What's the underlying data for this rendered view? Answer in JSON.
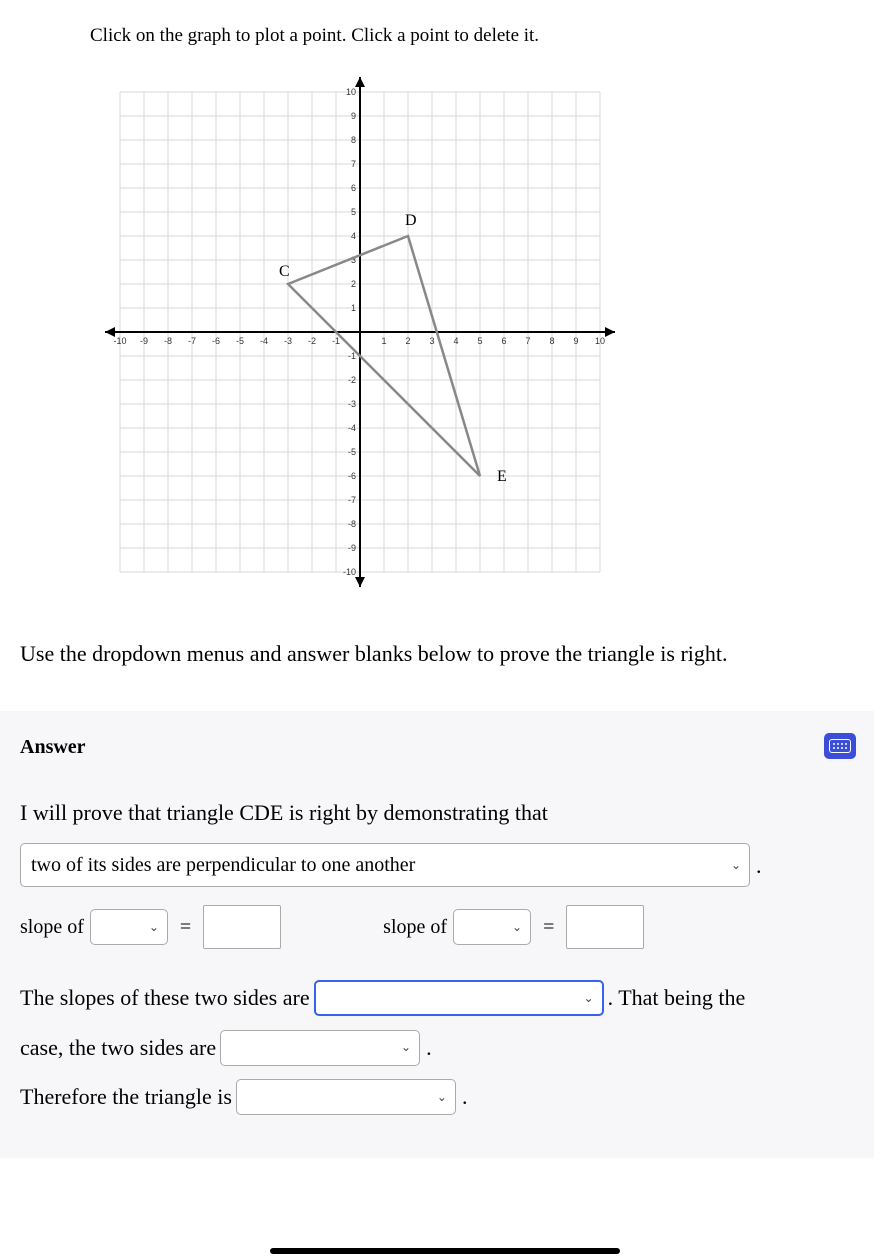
{
  "instruction": "Click on the graph to plot a point. Click a point to delete it.",
  "prompt2": "Use the dropdown menus and answer blanks below to prove the triangle is right.",
  "answer_header": "Answer",
  "proof_intro": "I will prove that triangle CDE is right by demonstrating that",
  "perpendicular_option": "two of its sides are perpendicular to one another",
  "slope_of": "slope of",
  "equals": "=",
  "slopes_line_prefix": "The slopes of these two sides are",
  "slopes_line_suffix": ". That being the",
  "case_line_prefix": "case, the two sides are",
  "therefore_prefix": "Therefore the triangle is",
  "period": ".",
  "chart_data": {
    "type": "scatter",
    "title": "",
    "xlabel": "",
    "ylabel": "",
    "xlim": [
      -10,
      10
    ],
    "ylim": [
      -10,
      10
    ],
    "x_ticks": [
      -10,
      -9,
      -8,
      -7,
      -6,
      -5,
      -4,
      -3,
      -2,
      -1,
      1,
      2,
      3,
      4,
      5,
      6,
      7,
      8,
      9,
      10
    ],
    "y_ticks": [
      -10,
      -9,
      -8,
      -7,
      -6,
      -5,
      -4,
      -3,
      -2,
      -1,
      1,
      2,
      3,
      4,
      5,
      6,
      7,
      8,
      9,
      10
    ],
    "points": [
      {
        "label": "C",
        "x": -3,
        "y": 2
      },
      {
        "label": "D",
        "x": 2,
        "y": 4
      },
      {
        "label": "E",
        "x": 5,
        "y": -6
      }
    ],
    "segments": [
      {
        "from": "C",
        "to": "D"
      },
      {
        "from": "D",
        "to": "E"
      },
      {
        "from": "E",
        "to": "C"
      }
    ]
  }
}
